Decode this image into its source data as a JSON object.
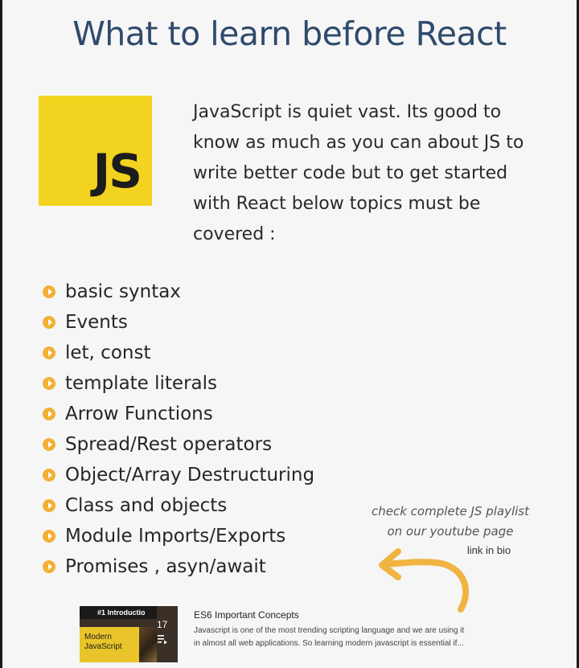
{
  "title": "What to learn before React",
  "logo_text": "JS",
  "intro_lines": [
    "JavaScript is quiet vast. Its good to",
    "know as much as you can about JS to",
    "write better code but to get started",
    "with React below  topics must be",
    "covered :"
  ],
  "topics": [
    "basic syntax",
    "Events",
    "let, const",
    "template literals",
    "Arrow Functions",
    "Spread/Rest operators",
    "Object/Array Destructuring",
    "Class and objects",
    "Module Imports/Exports",
    "Promises , asyn/await"
  ],
  "note": {
    "line1": "check complete JS playlist",
    "line2": "on our youtube page",
    "link": "link in bio"
  },
  "playlist_card": {
    "thumb_label": "#1 Introductio",
    "thumb_subtitle_1": "Modern",
    "thumb_subtitle_2": "JavaScript",
    "count": "17",
    "title": "ES6 Important Concepts",
    "description_1": "Javascript is one of the most trending scripting language and we are using it",
    "description_2": "in almost all web applications. So learning modern javascript is essential if..."
  },
  "colors": {
    "title": "#2f4a6b",
    "logo_bg": "#f2d31f",
    "bullet": "#f2b035",
    "arrow": "#f0b443"
  },
  "icons": [
    "play-bullet-icon",
    "curved-arrow-icon",
    "playlist-icon"
  ]
}
